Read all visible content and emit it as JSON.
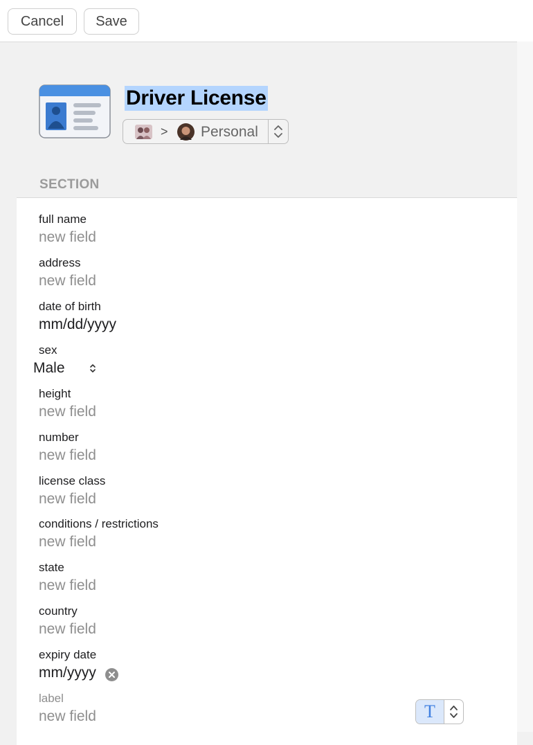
{
  "toolbar": {
    "cancel_label": "Cancel",
    "save_label": "Save"
  },
  "item": {
    "title": "Driver License",
    "icon": "driver-license-card-icon",
    "vault": {
      "account_avatar": "group-photo-avatar",
      "separator": ">",
      "name": "Personal",
      "person_avatar": "person-photo-avatar"
    }
  },
  "section": {
    "title": "SECTION",
    "fields": [
      {
        "label": "full name",
        "value": "new field"
      },
      {
        "label": "address",
        "value": "new field"
      },
      {
        "label": "date of birth",
        "value": "mm/dd/yyyy"
      },
      {
        "label": "sex",
        "value": "Male"
      },
      {
        "label": "height",
        "value": "new field"
      },
      {
        "label": "number",
        "value": "new field"
      },
      {
        "label": "license class",
        "value": "new field"
      },
      {
        "label": "conditions / restrictions",
        "value": "new field"
      },
      {
        "label": "state",
        "value": "new field"
      },
      {
        "label": "country",
        "value": "new field"
      },
      {
        "label": "expiry date",
        "value": "mm/yyyy"
      },
      {
        "label": "label",
        "value": "new field",
        "field_type_icon": "text-type-icon"
      }
    ]
  },
  "colors": {
    "title_highlight": "#b4d5fe",
    "placeholder_text": "#8e8e8e",
    "section_header": "#9b9b9b",
    "accent": "#3f7fe0",
    "card_icon_blue": "#4a90e2"
  }
}
